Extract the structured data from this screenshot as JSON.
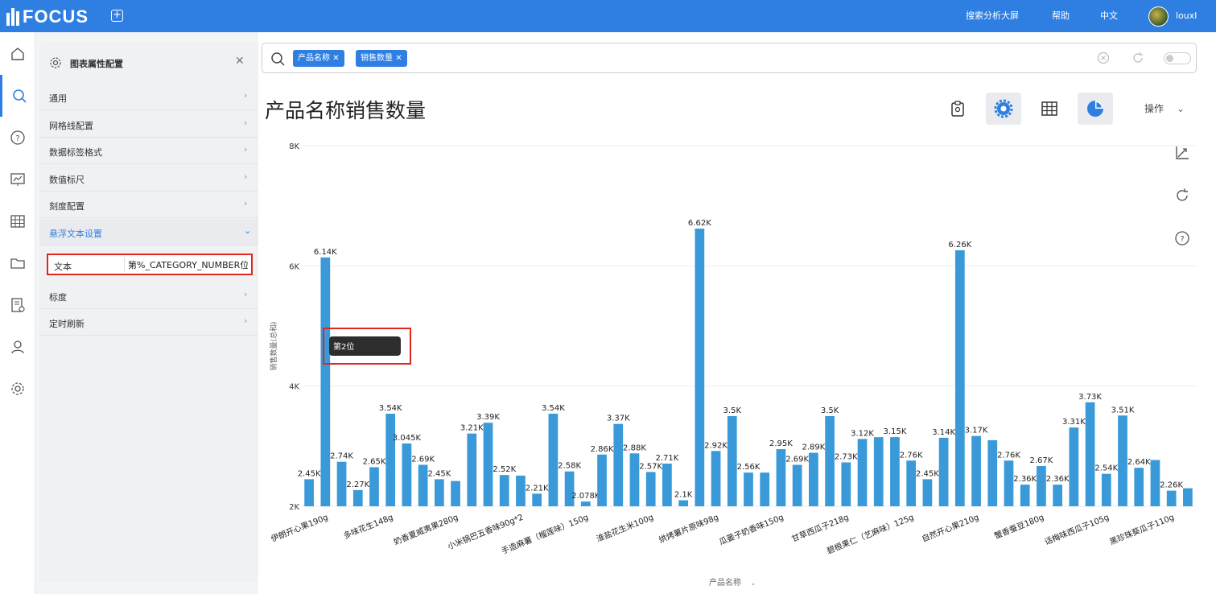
{
  "app": {
    "logo": "FOCUS",
    "top_right": [
      "搜索分析大屏",
      "帮助",
      "中文"
    ],
    "user": "louxl",
    "accent": "#2f7fe3",
    "icons": {
      "add": "plus-square-icon",
      "avatar": "user-avatar"
    }
  },
  "sidebar_nav": [
    "home-icon",
    "search-icon",
    "help-icon",
    "chart-board-icon",
    "table-icon",
    "folder-icon",
    "report-settings-icon",
    "user-icon",
    "gear-icon"
  ],
  "panel": {
    "title": "图表属性配置",
    "items_before": [
      "通用",
      "网格线配置",
      "数据标签格式",
      "数值标尺",
      "刻度配置"
    ],
    "open_item": "悬浮文本设置",
    "field": {
      "label": "文本",
      "value": "第%_CATEGORY_NUMBER位"
    },
    "items_after": [
      "标度",
      "定时刷新"
    ]
  },
  "search": {
    "tags": [
      "产品名称",
      "销售数量"
    ]
  },
  "chart_title": "产品名称销售数量",
  "toolbar": {
    "ops_label": "操作",
    "icons": [
      "clipboard-icon",
      "settings-icon",
      "table-view-icon",
      "pie-chart-icon"
    ]
  },
  "right_tools": [
    "axis-icon",
    "refresh-icon",
    "help-icon"
  ],
  "tooltip": {
    "text": "第2位",
    "highlight_color": "#e0261d"
  },
  "chart_data": {
    "type": "bar",
    "color": "#3a9ad9",
    "xlabel": "产品名称",
    "ylabel": "销售数量(总和)",
    "ylim": [
      2000,
      8000
    ],
    "yticks": [
      2000,
      4000,
      6000,
      8000
    ],
    "ytick_labels": [
      "2K",
      "4K",
      "6K",
      "8K"
    ],
    "category_labels": [
      "伊朗开心果190g",
      "多味花生148g",
      "奶香夏威夷果280g",
      "小米锅巴五香味90g*2",
      "手造麻薯（榴莲味）150g",
      "淮盐花生米100g",
      "烘烤薯片原味98g",
      "瓜蒌子奶香味150g",
      "甘草西瓜子218g",
      "碧根果仁（艺麻味）125g",
      "自然开心果210g",
      "蟹香蚕豆180g",
      "话梅味西瓜子105g",
      "黑珍珠葵瓜子110g"
    ],
    "values": [
      2450,
      6140,
      2740,
      2270,
      2650,
      3540,
      3045,
      2690,
      2450,
      2420,
      3210,
      3390,
      2520,
      2510,
      2210,
      3540,
      2580,
      2078,
      2860,
      3370,
      2880,
      2570,
      2710,
      2100,
      6620,
      2920,
      3500,
      2560,
      2560,
      2950,
      2690,
      2890,
      3500,
      2730,
      3120,
      3150,
      3150,
      2760,
      2450,
      3140,
      6260,
      3170,
      3100,
      2760,
      2360,
      2670,
      2360,
      3310,
      3730,
      2540,
      3510,
      2640,
      2770,
      2260,
      2300
    ],
    "labels": [
      "2.45K",
      "6.14K",
      "2.74K",
      "2.27K",
      "2.65K",
      "3.54K",
      "3.045K",
      "2.69K",
      "2.45K",
      "",
      "3.21K",
      "3.39K",
      "2.52K",
      "",
      "2.21K",
      "3.54K",
      "2.58K",
      "2.078K",
      "2.86K",
      "3.37K",
      "2.88K",
      "2.57K",
      "2.71K",
      "2.1K",
      "6.62K",
      "2.92K",
      "3.5K",
      "2.56K",
      "",
      "2.95K",
      "2.69K",
      "2.89K",
      "3.5K",
      "2.73K",
      "3.12K",
      "",
      "3.15K",
      "2.76K",
      "2.45K",
      "3.14K",
      "6.26K",
      "3.17K",
      "",
      "2.76K",
      "2.36K",
      "2.67K",
      "2.36K",
      "3.31K",
      "3.73K",
      "2.54K",
      "3.51K",
      "2.64K",
      "",
      "2.26K",
      ""
    ]
  }
}
